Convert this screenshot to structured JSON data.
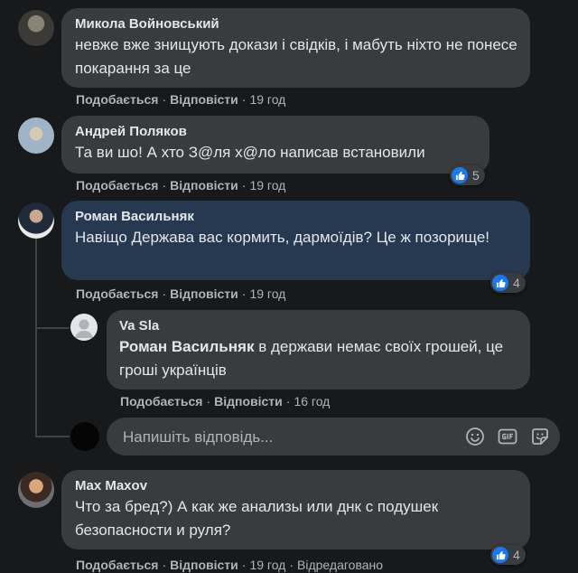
{
  "comments": [
    {
      "author": "Микола Войновський",
      "text": "невже вже знищують докази і свідків, і мабуть ніхто не понесе покарання за це",
      "like": "Подобається",
      "reply": "Відповісти",
      "time": "19 год"
    },
    {
      "author": "Андрей Поляков",
      "text": "Та ви шо! А хто З@ля х@ло написав встановили",
      "like": "Подобається",
      "reply": "Відповісти",
      "time": "19 год",
      "reactions": "5"
    },
    {
      "author": "Роман Васильняк",
      "text": "Навіщо Держава вас кормить, дармоїдів? Це ж позорище!",
      "like": "Подобається",
      "reply": "Відповісти",
      "time": "19 год",
      "reactions": "4",
      "reply_item": {
        "author": "Va Sla",
        "mention": "Роман Васильняк",
        "text": " в держави немає своїх грошей, це гроші українців",
        "like": "Подобається",
        "reply": "Відповісти",
        "time": "16 год"
      }
    },
    {
      "author": "Max Maxov",
      "text": "Что за бред?) А как же анализы или днк с подушек безопасности и руля?",
      "like": "Подобається",
      "reply": "Відповісти",
      "time": "19 год",
      "edited": "Відредаговано",
      "reactions": "4"
    }
  ],
  "reply_box": {
    "placeholder": "Напишіть відповідь...",
    "icons": [
      "emoji-icon",
      "gif-icon",
      "sticker-icon"
    ]
  },
  "colors": {
    "background": "#18191a",
    "bubble": "#3a3b3c",
    "highlight_bubble": "#263951",
    "like_blue": "#1877f2"
  }
}
